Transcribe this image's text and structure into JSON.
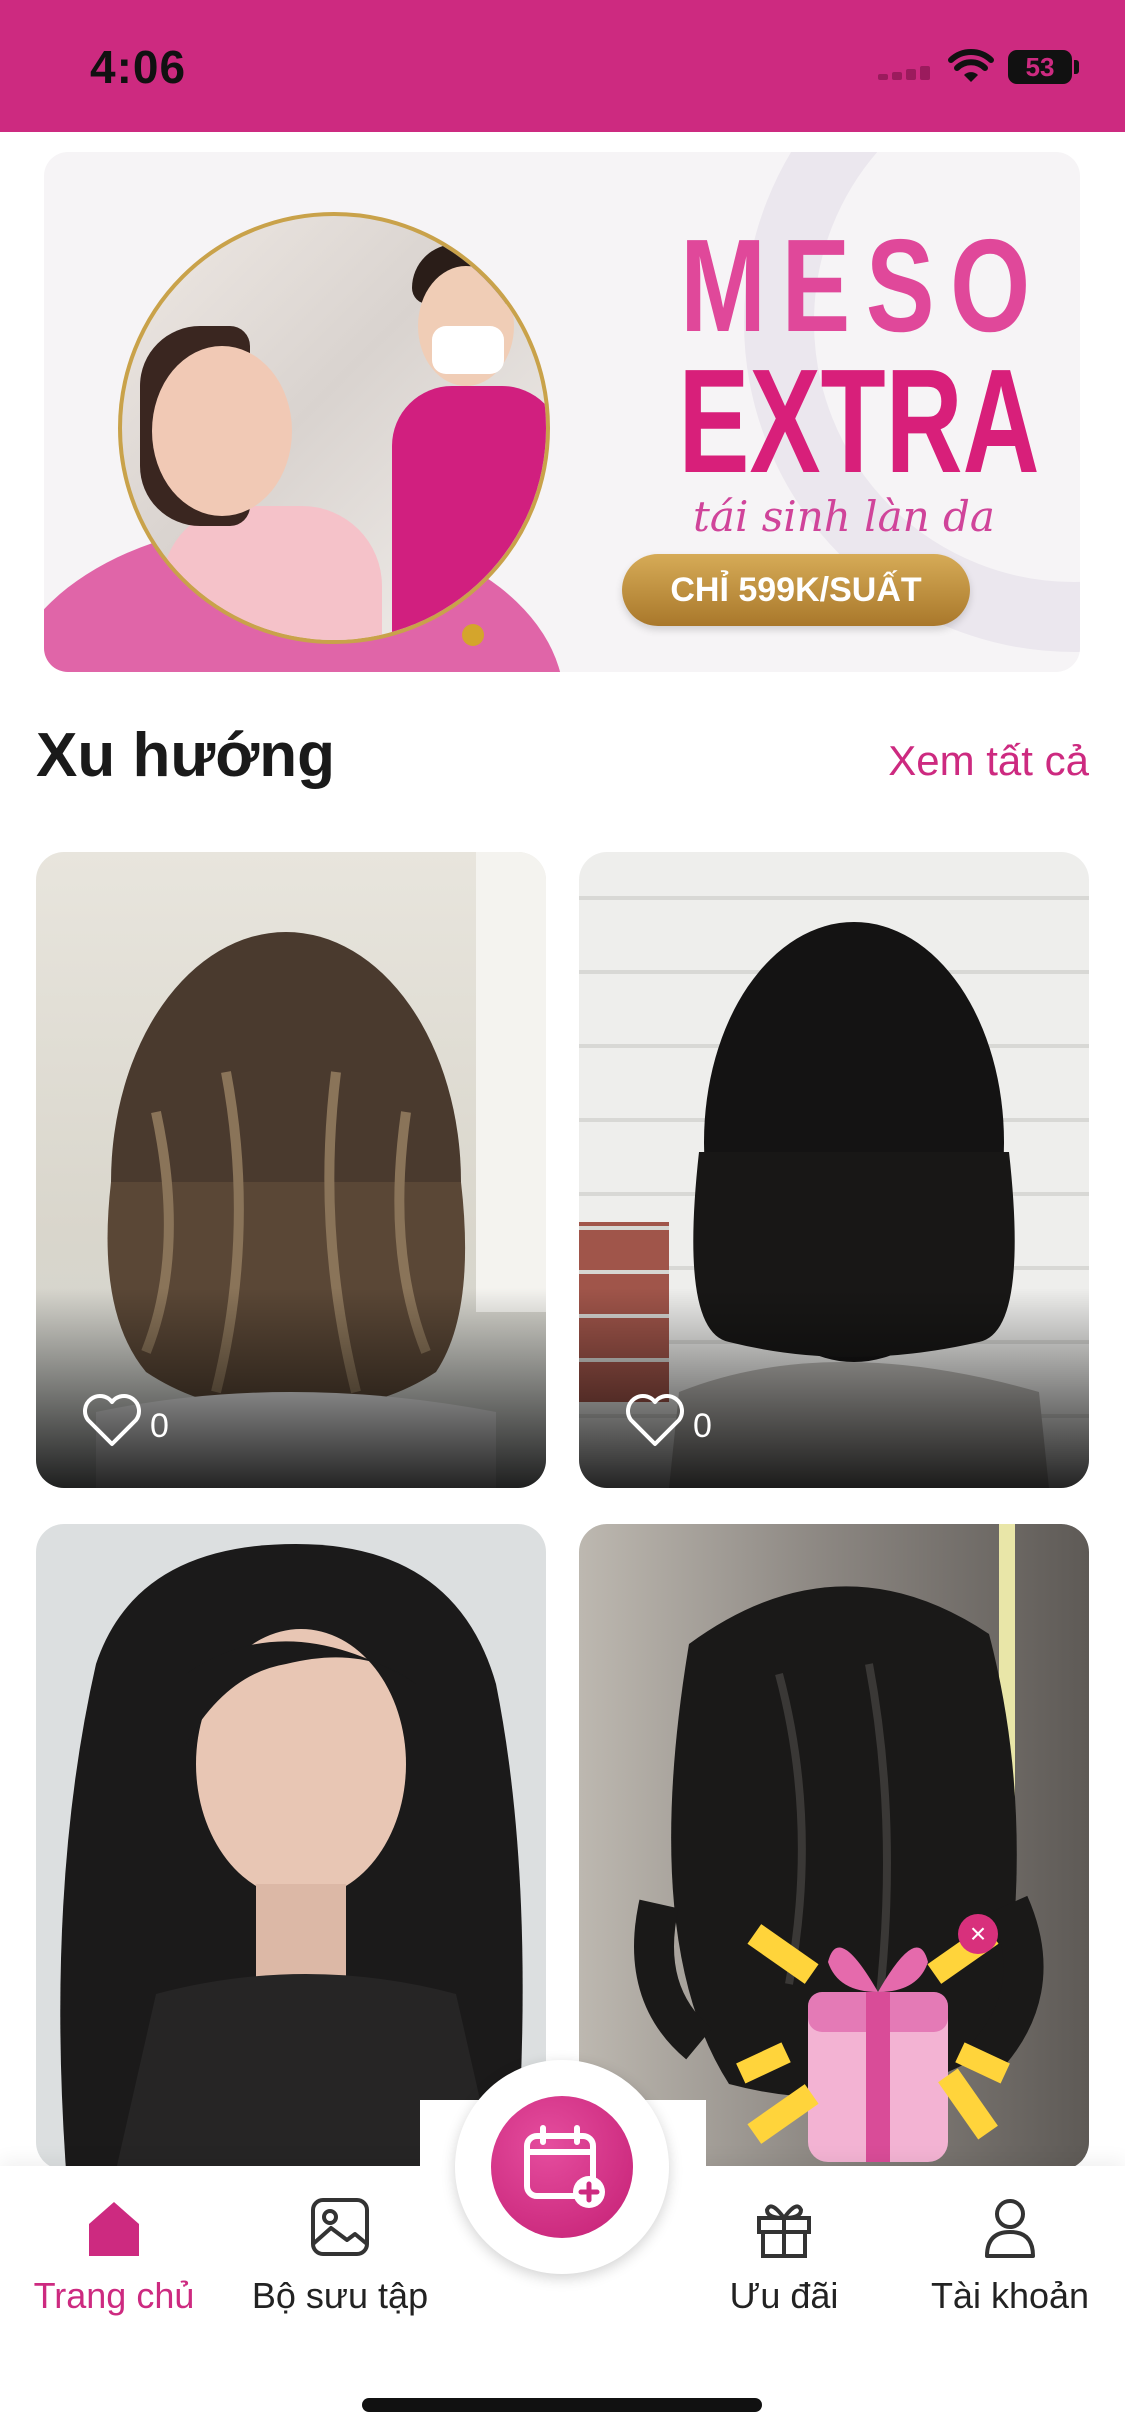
{
  "status_bar": {
    "time": "4:06",
    "battery": "53",
    "background": "#cd2a80"
  },
  "banner": {
    "title_line1": "MESO",
    "title_line2": "EXTRA",
    "tagline": "tái sinh làn da",
    "price_label": "CHỈ 599K/SUẤT",
    "accent": "#d81f7a"
  },
  "trending": {
    "title": "Xu hướng",
    "see_all": "Xem tất cả",
    "cards": [
      {
        "likes": "0"
      },
      {
        "likes": "0"
      },
      {
        "likes": ""
      },
      {
        "likes": ""
      }
    ]
  },
  "gift_popup": {
    "close_label": "×",
    "icon": "gift-box-icon"
  },
  "bottom_nav": {
    "items": [
      {
        "label": "Trang chủ",
        "icon": "home-icon",
        "active": true
      },
      {
        "label": "Bộ sưu tập",
        "icon": "gallery-icon",
        "active": false
      },
      {
        "label": "Ưu đãi",
        "icon": "gift-icon",
        "active": false
      },
      {
        "label": "Tài khoản",
        "icon": "account-icon",
        "active": false
      }
    ],
    "center_action_icon": "calendar-add-icon",
    "active_color": "#cd2a80"
  }
}
